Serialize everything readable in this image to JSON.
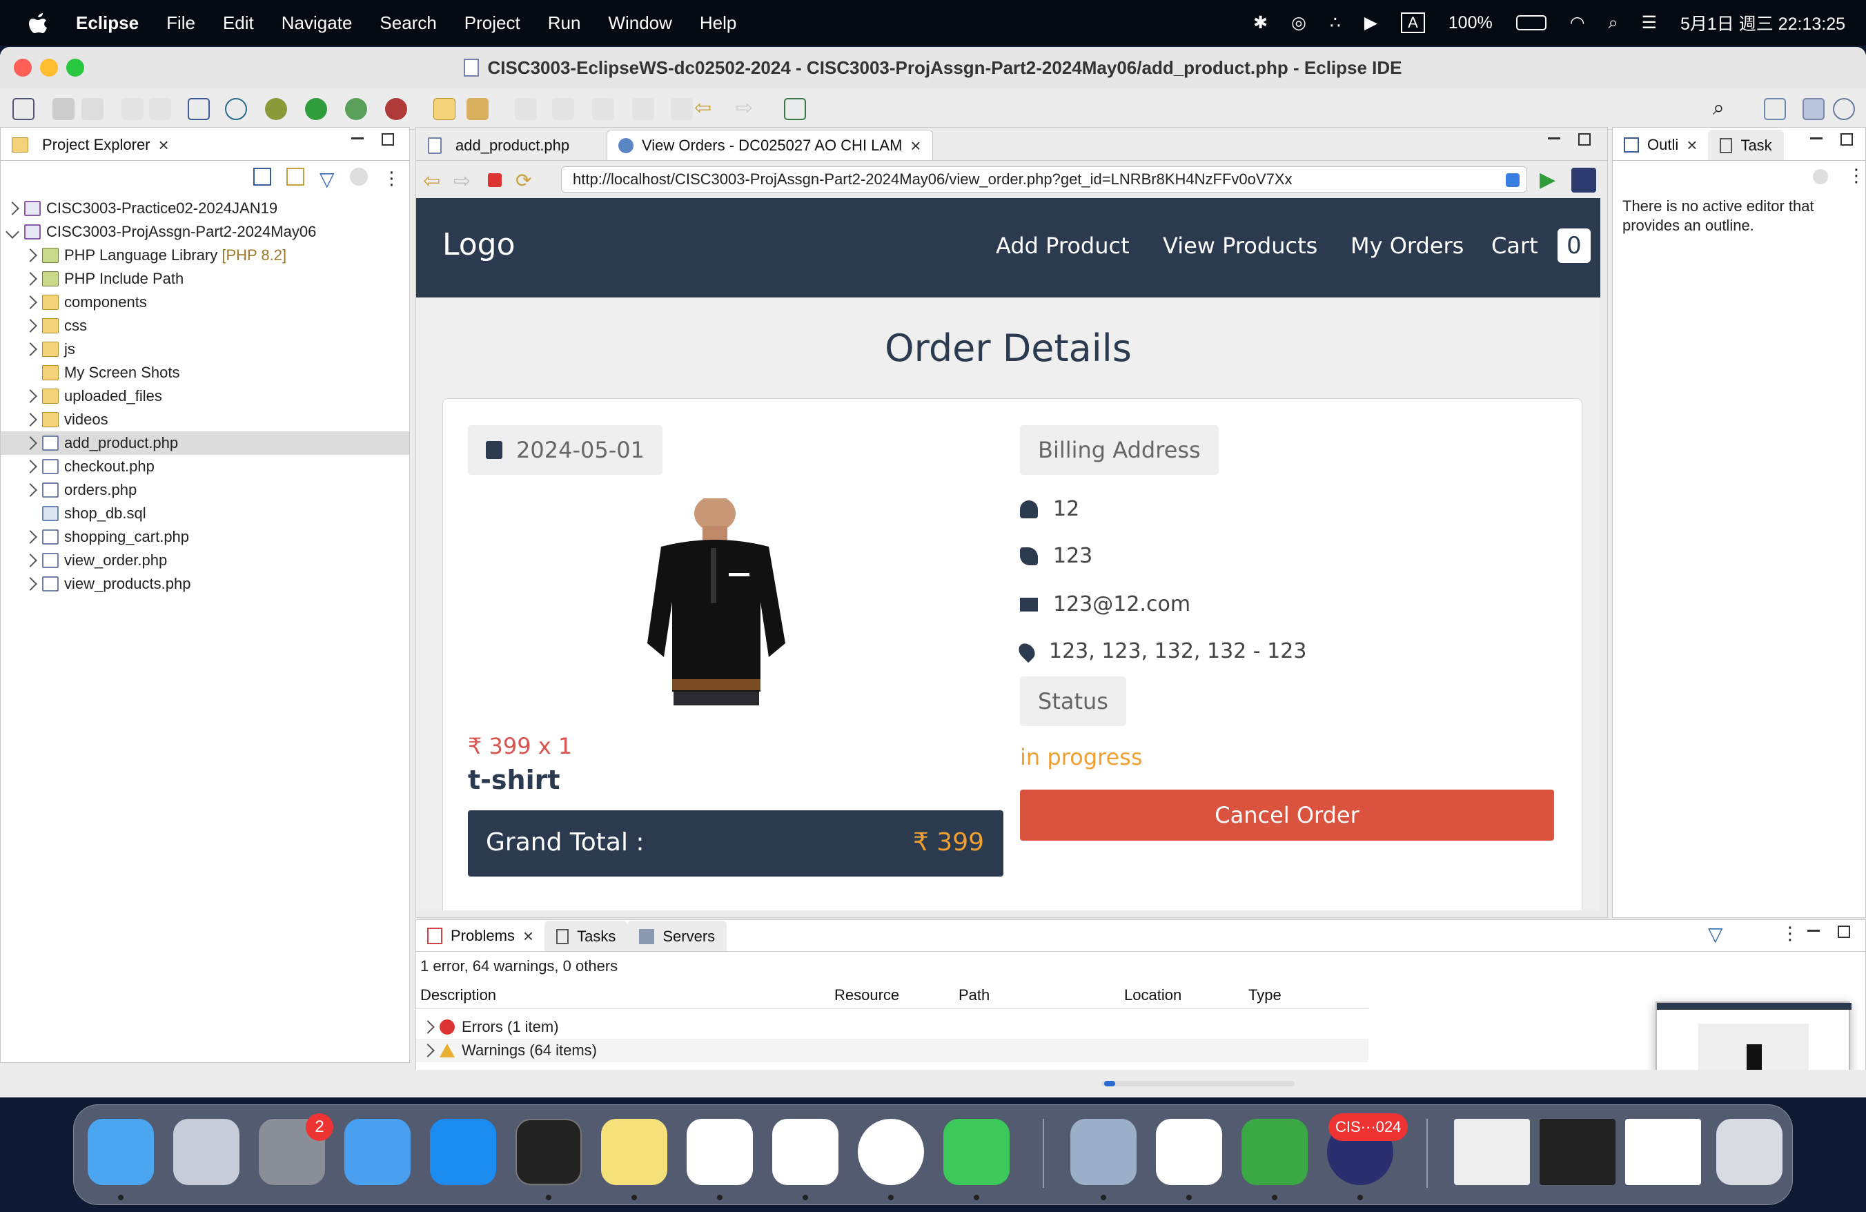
{
  "menubar": {
    "app": "Eclipse",
    "items": [
      "File",
      "Edit",
      "Navigate",
      "Search",
      "Project",
      "Run",
      "Window",
      "Help"
    ],
    "battery": "100%",
    "input_method": "A",
    "clock": "5月1日 週三 22:13:25"
  },
  "window": {
    "title": "CISC3003-EclipseWS-dc02502-2024 - CISC3003-ProjAssgn-Part2-2024May06/add_product.php - Eclipse IDE"
  },
  "explorer": {
    "tab": "Project Explorer",
    "items": [
      {
        "label": "CISC3003-Practice02-2024JAN19"
      },
      {
        "label": "CISC3003-ProjAssgn-Part2-2024May06"
      },
      {
        "label": "PHP Language Library",
        "extra": "[PHP 8.2]"
      },
      {
        "label": "PHP Include Path"
      },
      {
        "label": "components"
      },
      {
        "label": "css"
      },
      {
        "label": "js"
      },
      {
        "label": "My Screen Shots"
      },
      {
        "label": "uploaded_files"
      },
      {
        "label": "videos"
      },
      {
        "label": "add_product.php"
      },
      {
        "label": "checkout.php"
      },
      {
        "label": "orders.php"
      },
      {
        "label": "shop_db.sql"
      },
      {
        "label": "shopping_cart.php"
      },
      {
        "label": "view_order.php"
      },
      {
        "label": "view_products.php"
      }
    ]
  },
  "editor": {
    "tabs": [
      "add_product.php",
      "View Orders - DC025027 AO CHI LAM"
    ],
    "url": "http://localhost/CISC3003-ProjAssgn-Part2-2024May06/view_order.php?get_id=LNRBr8KH4NzFFv0oV7Xx"
  },
  "page": {
    "logo": "Logo",
    "nav": [
      "Add Product",
      "View Products",
      "My Orders",
      "Cart"
    ],
    "cart_count": "0",
    "heading": "Order Details",
    "date": "2024-05-01",
    "price": "₹ 399 x 1",
    "product_name": "t-shirt",
    "grand_total_label": "Grand Total :",
    "grand_total_value": "₹ 399",
    "billing_label": "Billing Address",
    "name": "12",
    "phone": "123",
    "email": "123@12.com",
    "address": "123, 123, 132, 132 - 123",
    "status_label": "Status",
    "status_value": "in progress",
    "cancel_button": "Cancel Order"
  },
  "outline": {
    "tabs": [
      "Outli",
      "Task"
    ],
    "message": "There is no active editor that provides an outline."
  },
  "problems": {
    "tabs": [
      "Problems",
      "Tasks",
      "Servers"
    ],
    "summary": "1 error, 64 warnings, 0 others",
    "columns": [
      "Description",
      "Resource",
      "Path",
      "Location",
      "Type"
    ],
    "rows": [
      "Errors (1 item)",
      "Warnings (64 items)"
    ]
  },
  "dock": {
    "badges": {
      "settings": "2",
      "eclipse": "CIS···024"
    }
  },
  "colors": {
    "nav": "#2b3a4f",
    "price": "#d9534f",
    "status": "#f0a030",
    "cancel": "#d9533f"
  }
}
